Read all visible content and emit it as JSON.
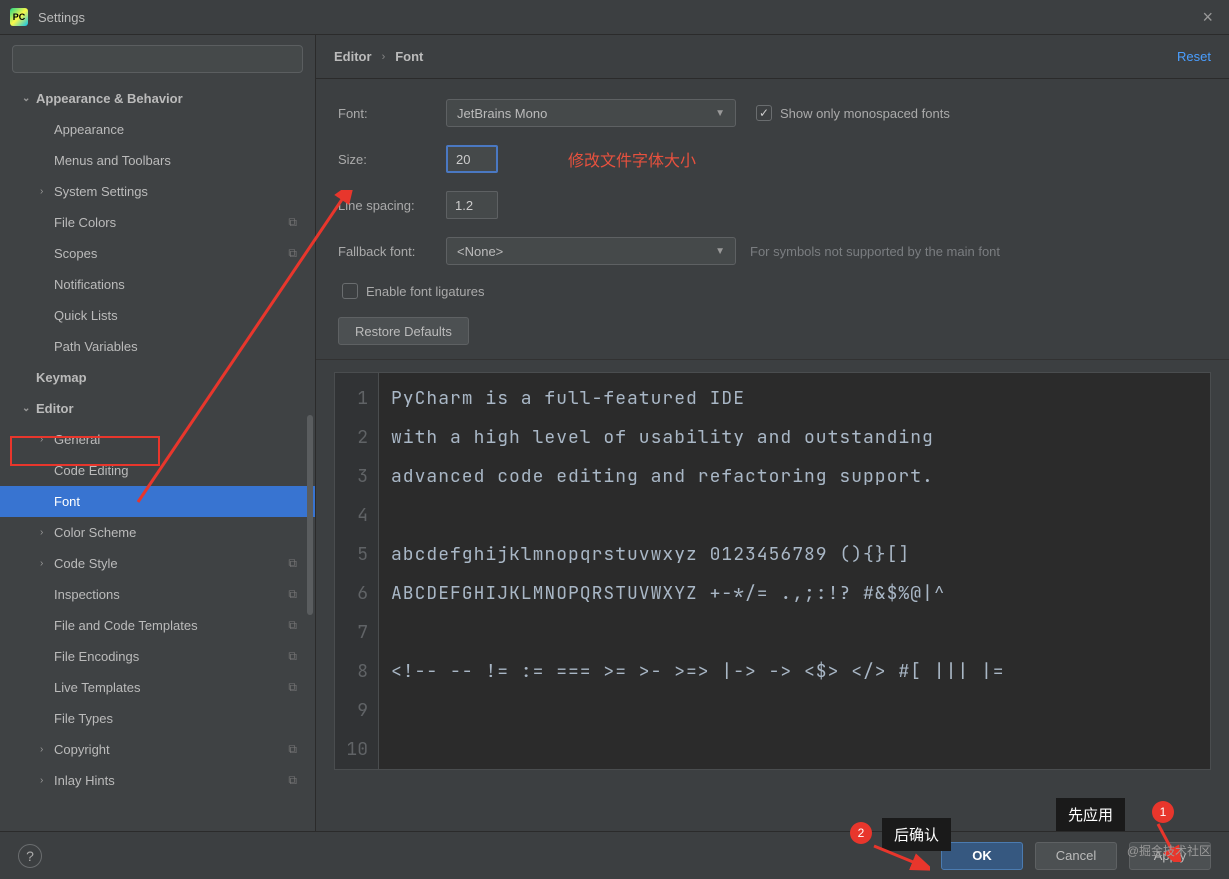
{
  "title": "Settings",
  "sidebar": {
    "search_placeholder": "",
    "items": [
      {
        "label": "Appearance & Behavior",
        "bold": true,
        "arrow": "down",
        "indent": 0
      },
      {
        "label": "Appearance",
        "indent": 1
      },
      {
        "label": "Menus and Toolbars",
        "indent": 1
      },
      {
        "label": "System Settings",
        "arrow": "right",
        "indent": 1
      },
      {
        "label": "File Colors",
        "indent": 1,
        "gear": true
      },
      {
        "label": "Scopes",
        "indent": 1,
        "gear": true
      },
      {
        "label": "Notifications",
        "indent": 1
      },
      {
        "label": "Quick Lists",
        "indent": 1
      },
      {
        "label": "Path Variables",
        "indent": 1
      },
      {
        "label": "Keymap",
        "bold": true,
        "indent": 0
      },
      {
        "label": "Editor",
        "bold": true,
        "arrow": "down",
        "indent": 0,
        "redbox": true
      },
      {
        "label": "General",
        "arrow": "right",
        "indent": 1
      },
      {
        "label": "Code Editing",
        "indent": 1
      },
      {
        "label": "Font",
        "indent": 1,
        "selected": true
      },
      {
        "label": "Color Scheme",
        "arrow": "right",
        "indent": 1
      },
      {
        "label": "Code Style",
        "arrow": "right",
        "indent": 1,
        "gear": true
      },
      {
        "label": "Inspections",
        "indent": 1,
        "gear": true
      },
      {
        "label": "File and Code Templates",
        "indent": 1,
        "gear": true
      },
      {
        "label": "File Encodings",
        "indent": 1,
        "gear": true
      },
      {
        "label": "Live Templates",
        "indent": 1,
        "gear": true
      },
      {
        "label": "File Types",
        "indent": 1
      },
      {
        "label": "Copyright",
        "arrow": "right",
        "indent": 1,
        "gear": true
      },
      {
        "label": "Inlay Hints",
        "arrow": "right",
        "indent": 1,
        "gear": true
      }
    ]
  },
  "breadcrumb": {
    "root": "Editor",
    "sep": "›",
    "leaf": "Font",
    "reset": "Reset"
  },
  "form": {
    "font_label": "Font:",
    "font_value": "JetBrains Mono",
    "mono_label": "Show only monospaced fonts",
    "size_label": "Size:",
    "size_value": "20",
    "size_anno": "修改文件字体大小",
    "spacing_label": "Line spacing:",
    "spacing_value": "1.2",
    "fallback_label": "Fallback font:",
    "fallback_value": "<None>",
    "fallback_hint": "For symbols not supported by the main font",
    "ligatures_label": "Enable font ligatures",
    "restore": "Restore Defaults"
  },
  "preview_lines": [
    "PyCharm is a full-featured IDE",
    "with a high level of usability and outstanding",
    "advanced code editing and refactoring support.",
    "",
    "abcdefghijklmnopqrstuvwxyz 0123456789 (){}[]",
    "ABCDEFGHIJKLMNOPQRSTUVWXYZ +-*/= .,;:!? #&$%@|^",
    "",
    "<!-- -- != := === >= >- >=> |-> -> <$> </> #[ ||| |=",
    "",
    ""
  ],
  "footer": {
    "ok": "OK",
    "cancel": "Cancel",
    "apply": "Apply"
  },
  "annotations": {
    "tip_apply": "先应用",
    "tip_ok": "后确认",
    "badge1": "1",
    "badge2": "2",
    "watermark": "@掘金技术社区"
  }
}
